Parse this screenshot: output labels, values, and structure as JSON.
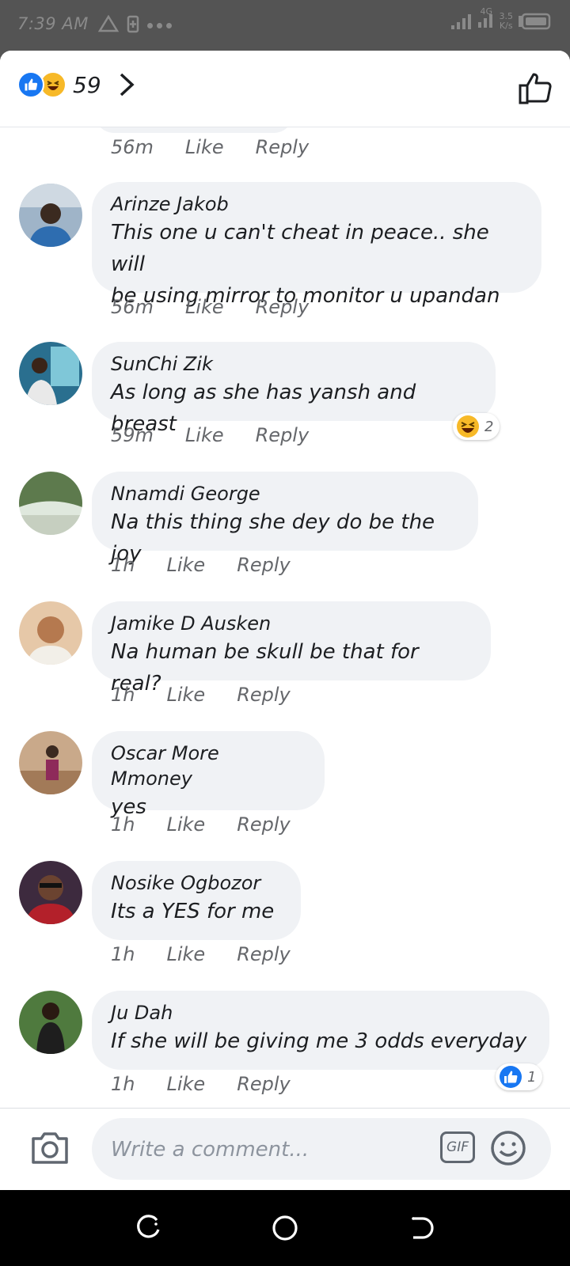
{
  "status_bar": {
    "time": "7:39 AM",
    "network": "4G",
    "speed_value": "3.5",
    "speed_unit": "K/s"
  },
  "header": {
    "reaction_count": "59",
    "reaction_icons": [
      "like-icon",
      "haha-icon"
    ]
  },
  "top_partial_comment": {
    "time": "56m",
    "like_label": "Like",
    "reply_label": "Reply"
  },
  "comments": [
    {
      "author": "Arinze Jakob",
      "lines": [
        "This one u can't cheat in peace.. she will",
        "be using mirror to monitor u upandan"
      ],
      "time": "56m",
      "like_label": "Like",
      "reply_label": "Reply"
    },
    {
      "author": "SunChi Zik",
      "lines": [
        "As long as she has yansh and breast"
      ],
      "time": "59m",
      "like_label": "Like",
      "reply_label": "Reply",
      "reaction": {
        "icon": "haha-icon",
        "count": "2"
      }
    },
    {
      "author": "Nnamdi George",
      "lines": [
        "Na this thing she dey do be the joy"
      ],
      "time": "1h",
      "like_label": "Like",
      "reply_label": "Reply"
    },
    {
      "author": "Jamike D Ausken",
      "lines": [
        "Na human be skull be that for real?"
      ],
      "time": "1h",
      "like_label": "Like",
      "reply_label": "Reply"
    },
    {
      "author": "Oscar More Mmoney",
      "lines": [
        "yes"
      ],
      "time": "1h",
      "like_label": "Like",
      "reply_label": "Reply"
    },
    {
      "author": "Nosike Ogbozor",
      "lines": [
        "Its a YES for me"
      ],
      "time": "1h",
      "like_label": "Like",
      "reply_label": "Reply"
    },
    {
      "author": "Ju Dah",
      "lines": [
        "If she will be giving me 3 odds everyday"
      ],
      "time": "1h",
      "like_label": "Like",
      "reply_label": "Reply",
      "reaction": {
        "icon": "like-icon",
        "count": "1"
      }
    }
  ],
  "composer": {
    "placeholder": "Write a comment...",
    "gif_label": "GIF"
  },
  "colors": {
    "like_blue": "#1877f2",
    "haha_yellow": "#f7b928",
    "bubble_bg": "#f0f2f5",
    "meta_gray": "#65676b"
  }
}
